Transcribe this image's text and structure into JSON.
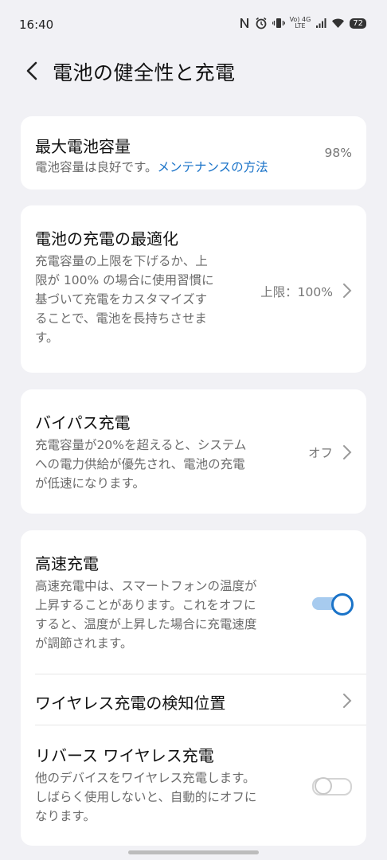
{
  "status_bar": {
    "time": "16:40",
    "network_label_top": "Vo) 4G",
    "network_label_bottom": "LTE",
    "battery": "72"
  },
  "header": {
    "title": "電池の健全性と充電"
  },
  "max_capacity": {
    "title": "最大電池容量",
    "desc_prefix": "電池容量は良好です。",
    "desc_link": "メンテナンスの方法",
    "value": "98%"
  },
  "optimization": {
    "title": "電池の充電の最適化",
    "desc_lines": [
      "充電容量の上限を下げるか、上",
      "限が 100% の場合に使用習慣に",
      "基づいて充電をカスタマイズす",
      "ることで、電池を長持ちさせま",
      "す。"
    ],
    "value": "上限：100%"
  },
  "bypass": {
    "title": "バイパス充電",
    "desc_lines": [
      "充電容量が20%を超えると、システム",
      "への電力供給が優先され、電池の充電",
      "が低速になります。"
    ],
    "value": "オフ"
  },
  "fast_charge": {
    "title": "高速充電",
    "desc_lines": [
      "高速充電中は、スマートフォンの温度が",
      "上昇することがあります。これをオフに",
      "すると、温度が上昇した場合に充電速度",
      "が調節されます。"
    ],
    "toggle_state": "on"
  },
  "wireless_position": {
    "title": "ワイヤレス充電の検知位置"
  },
  "reverse_wireless": {
    "title": "リバース ワイヤレス充電",
    "desc_lines": [
      "他のデバイスをワイヤレス充電します。",
      "しばらく使用しないと、自動的にオフに",
      "なります。"
    ],
    "toggle_state": "off"
  },
  "colors": {
    "background": "#f1f1f5",
    "card": "#ffffff",
    "accent": "#1a73c8"
  }
}
